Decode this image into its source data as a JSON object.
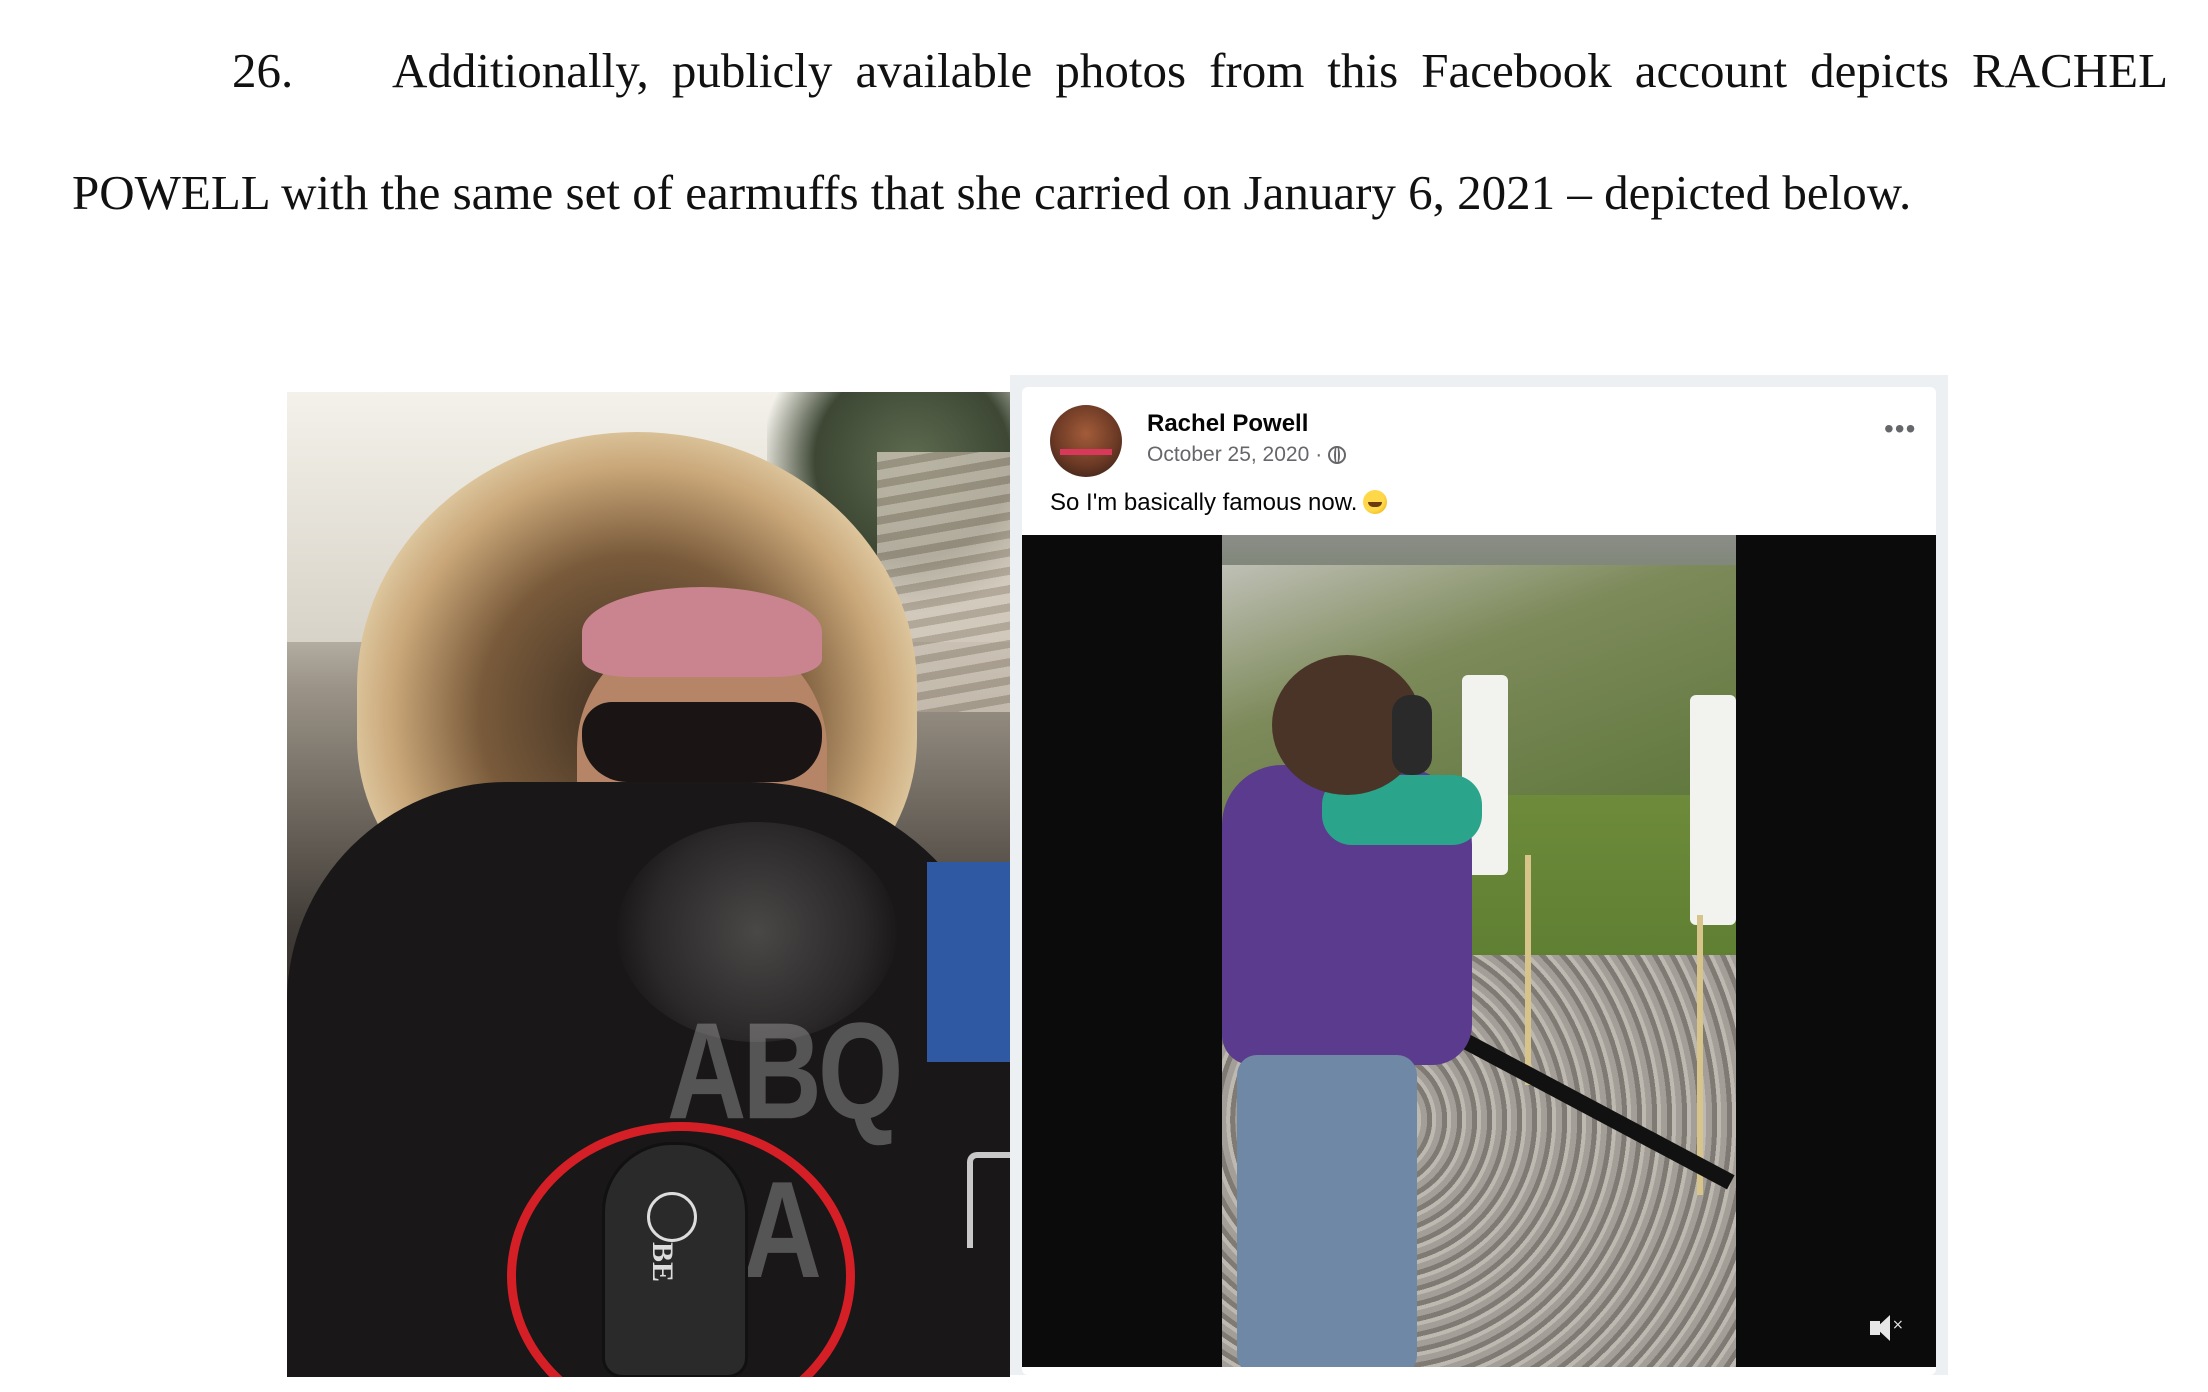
{
  "document": {
    "paragraph_number": "26.",
    "paragraph_text": "Additionally, publicly available photos from this Facebook account depicts RACHEL POWELL with the same set of earmuffs that she carried on January 6, 2021 – depicted below."
  },
  "left_photo": {
    "watermark": "ABQ RA",
    "earmuff_logo_text": "BE",
    "highlight_color": "#d51f26"
  },
  "facebook_post": {
    "author_name": "Rachel Powell",
    "date": "October 25, 2020",
    "date_separator": "·",
    "caption": "So I'm basically famous now.",
    "more_options_icon": "ellipsis-icon",
    "privacy_icon": "globe-icon",
    "reaction_emoji": "laughing-emoji",
    "video_muted_icon": "mute-icon",
    "mute_x": "×"
  }
}
